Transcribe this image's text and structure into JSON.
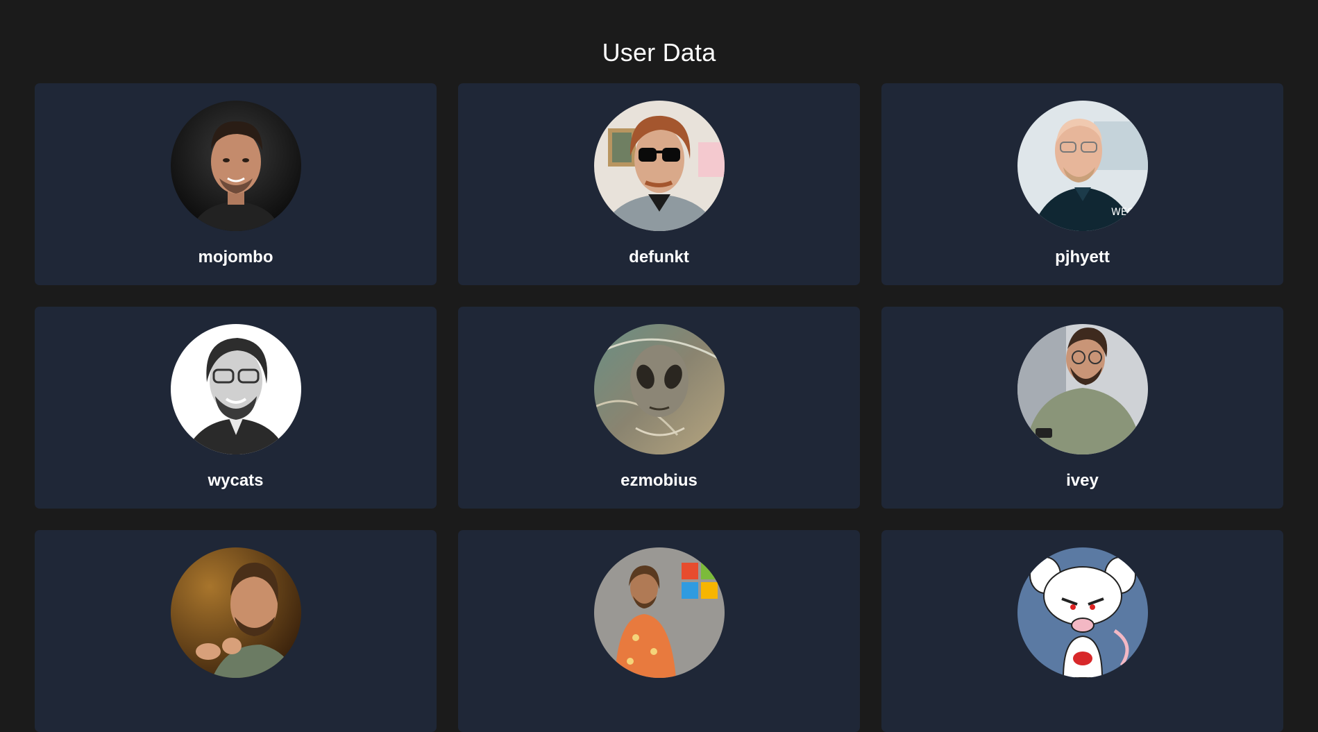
{
  "page": {
    "title": "User Data"
  },
  "users": [
    {
      "login": "mojombo"
    },
    {
      "login": "defunkt"
    },
    {
      "login": "pjhyett"
    },
    {
      "login": "wycats"
    },
    {
      "login": "ezmobius"
    },
    {
      "login": "ivey"
    },
    {
      "login": ""
    },
    {
      "login": ""
    },
    {
      "login": ""
    }
  ]
}
